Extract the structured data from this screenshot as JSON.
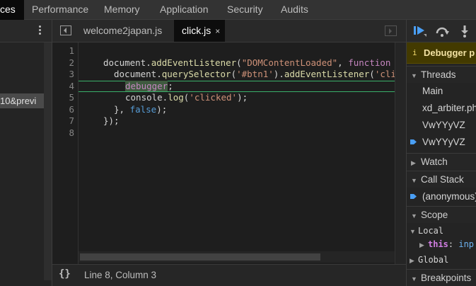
{
  "panel_tabs": [
    "ces",
    "Performance",
    "Memory",
    "Application",
    "Security",
    "Audits"
  ],
  "active_panel_tab": "ces",
  "navigator": {
    "selected_file": "10&previ"
  },
  "editor": {
    "tabs": [
      {
        "label": "welcome2japan.js",
        "active": false
      },
      {
        "label": "click.js",
        "active": true
      }
    ],
    "close_glyph": "×",
    "line_numbers": [
      "1",
      "2",
      "3",
      "4",
      "5",
      "6",
      "7",
      "8"
    ],
    "code": {
      "l2": {
        "a": "document.",
        "b": "addEventListener",
        "c": "(",
        "d": "\"DOMContentLoaded\"",
        "e": ", ",
        "f": "function"
      },
      "l3": {
        "a": "document.",
        "b": "querySelector",
        "c": "(",
        "d": "'#btn1'",
        "e": ").",
        "f": "addEventListener",
        "g": "(",
        "h": "'cli"
      },
      "l4": {
        "a": "debugger",
        "b": ";"
      },
      "l5": {
        "a": "console.",
        "b": "log",
        "c": "(",
        "d": "'clicked'",
        "e": ");"
      },
      "l6": {
        "a": "}, ",
        "b": "false",
        "c": ");"
      },
      "l7": {
        "a": "});"
      }
    },
    "paused_line": 4
  },
  "status_bar": {
    "braces": "{}",
    "position": "Line 8, Column 3"
  },
  "debugger": {
    "paused_banner": "Debugger p",
    "info_glyph": "i",
    "sections": {
      "threads": "Threads",
      "watch": "Watch",
      "call_stack": "Call Stack",
      "scope": "Scope",
      "breakpoints": "Breakpoints"
    },
    "threads": [
      "Main",
      "xd_arbiter.ph",
      "VwYYyVZ",
      "VwYYyVZ"
    ],
    "current_thread_index": 3,
    "call_stack": [
      "(anonymous)"
    ],
    "scope": {
      "local": "Local",
      "this_key": "this",
      "this_sep": ": ",
      "this_val": "inp",
      "global": "Global"
    }
  },
  "colors": {
    "accent_blue": "#4a9ff5",
    "paused_banner_bg": "#433a00",
    "highlight_line": "#3aaf6a"
  }
}
